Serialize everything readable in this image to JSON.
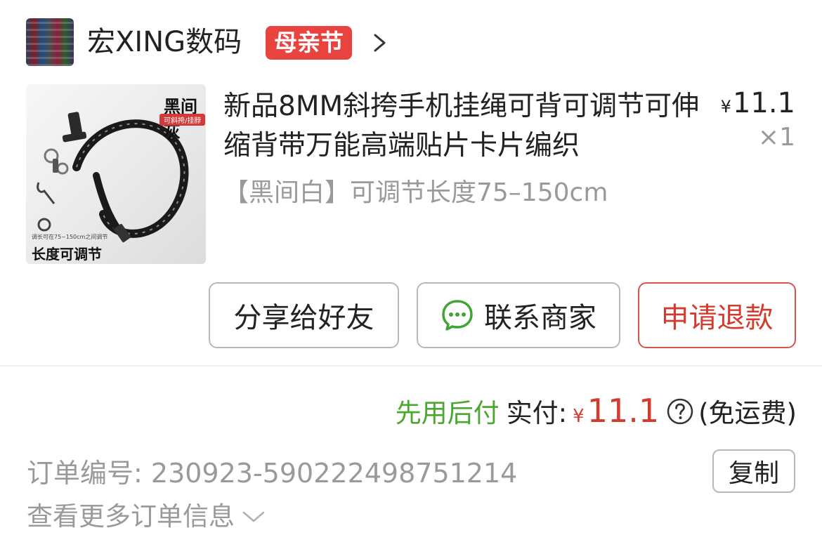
{
  "shop": {
    "name": "宏XING数码",
    "badge": "母亲节"
  },
  "product": {
    "title": "新品8MM斜挎手机挂绳可背可调节可伸缩背带万能高端贴片卡片编织",
    "spec": "【黑间白】可调节长度75–150cm",
    "price_currency": "¥",
    "price": "11.1",
    "quantity": "×1",
    "image_text": {
      "title": "黑间灰",
      "tag": "可斜挎/挂脖",
      "note": "调长可在75~150cm之间调节",
      "bottom": "长度可调节"
    }
  },
  "actions": {
    "share": "分享给好友",
    "contact": "联系商家",
    "refund": "申请退款"
  },
  "payment": {
    "pay_later": "先用后付",
    "label": "实付:",
    "currency": "¥",
    "amount": "11.1",
    "shipping": "(免运费)"
  },
  "order": {
    "number_label": "订单编号:",
    "number": "230923-590222498751214",
    "copy": "复制",
    "more": "查看更多订单信息"
  },
  "colors": {
    "accent_red": "#d23b2e",
    "badge_red": "#e8433e",
    "pay_later_green": "#4aa830",
    "chat_green": "#3fa534"
  },
  "icons": [
    "chevron-right-icon",
    "chat-bubble-icon",
    "help-circle-icon",
    "chevron-down-icon"
  ]
}
